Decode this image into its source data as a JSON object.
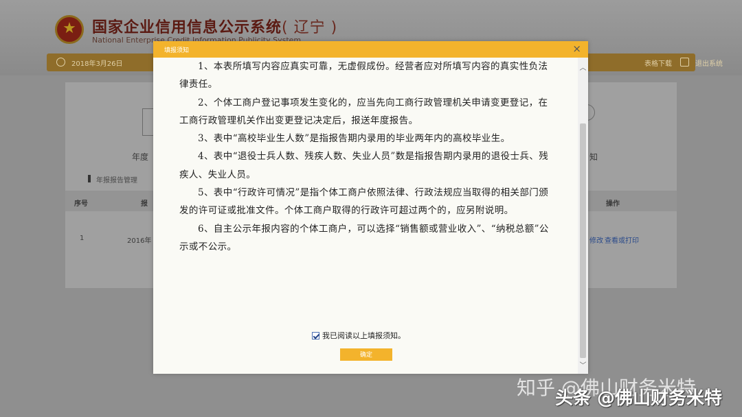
{
  "background": {
    "site_title": "国家企业信用信息公示系统",
    "region": "( 辽宁 )",
    "site_subtitle": "National Enterprise Credit Information Publicity System",
    "nav_date": "2018年3月26日",
    "nav_download": "表格下载",
    "nav_logout": "退出系统",
    "annual_left": "年度",
    "annual_right": "知",
    "section_title": "年报报告管理",
    "table_headers": [
      "序号",
      "报",
      "操作"
    ],
    "row": {
      "index": "1",
      "year": "2016年",
      "action_modify": "修改",
      "action_view_print": "查看或打印"
    }
  },
  "modal": {
    "title": "填报须知",
    "close_label": "×",
    "paragraphs": [
      "1、本表所填写内容应真实可靠，无虚假成份。经营者应对所填写内容的真实性负法律责任。",
      "2、个体工商户登记事项发生变化的，应当先向工商行政管理机关申请变更登记，在工商行政管理机关作出变更登记决定后，报送年度报告。",
      "3、表中“高校毕业生人数”是指报告期内录用的毕业两年内的高校毕业生。",
      "4、表中“退役士兵人数、残疾人数、失业人员”数是指报告期内录用的退役士兵、残疾人、失业人员。",
      "5、表中“行政许可情况”是指个体工商户依照法律、行政法规应当取得的相关部门颁发的许可证或批准文件。个体工商户取得的行政许可超过两个的，应另附说明。",
      "6、自主公示年报内容的个体工商户，可以选择“销售额或营业收入”、“纳税总额”公示或不公示。"
    ],
    "agree_label": "我已阅读以上填报须知。",
    "agree_checked": true,
    "confirm_label": "确定"
  },
  "watermarks": {
    "zhihu": "知乎 @佛山财务米特",
    "toutiao": "头条 @佛山财务米特"
  },
  "colors": {
    "accent": "#f3b32c",
    "nav": "#8f6d2a"
  }
}
